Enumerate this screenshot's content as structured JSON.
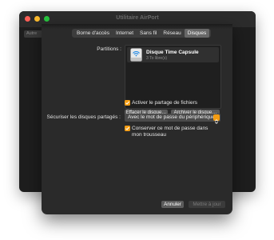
{
  "app": {
    "title": "Utilitaire AirPort"
  },
  "background_window": {
    "sidebar_label": "Autre"
  },
  "tabs": [
    {
      "label": "Borne d'accès",
      "active": false
    },
    {
      "label": "Internet",
      "active": false
    },
    {
      "label": "Sans fil",
      "active": false
    },
    {
      "label": "Réseau",
      "active": false
    },
    {
      "label": "Disques",
      "active": true
    }
  ],
  "disks": {
    "partitions_label": "Partitions :",
    "items": [
      {
        "name": "Disque Time Capsule",
        "size": "3 To libre(s)",
        "icon": "airport-disk-icon"
      }
    ],
    "erase_button": "Effacer le disque…",
    "archive_button": "Archiver le disque…",
    "file_sharing_label": "Activer le partage de fichiers",
    "file_sharing_checked": true,
    "secure_label": "Sécuriser les disques partagés :",
    "secure_value": "Avec le mot de passe du périphérique",
    "keychain_label_line1": "Conserver ce mot de passe dans",
    "keychain_label_line2": "mon trousseau",
    "keychain_checked": true
  },
  "footer": {
    "cancel_button": "Annuler",
    "update_button": "Mettre à jour"
  },
  "colors": {
    "accent": "#f39c12",
    "window_bg": "#2a2a2a",
    "control_bg": "#5a5a5a"
  }
}
